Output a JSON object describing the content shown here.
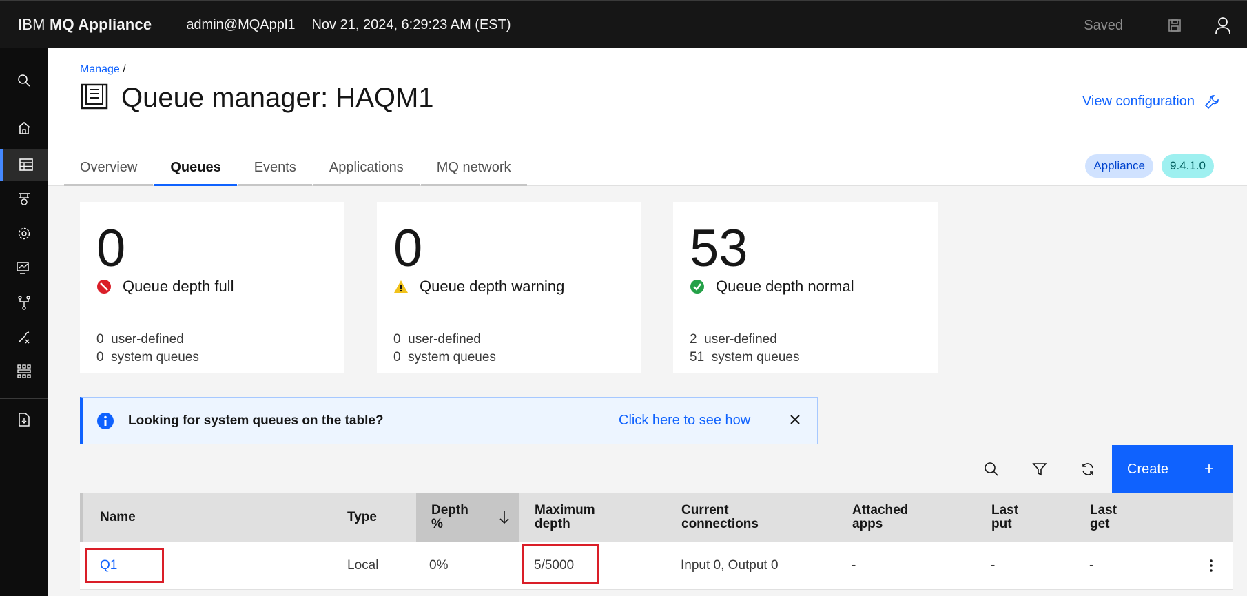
{
  "header": {
    "brand_light": "IBM ",
    "brand_bold": "MQ Appliance",
    "user": "admin@MQAppl1",
    "time": "Nov 21, 2024, 6:29:23 AM (EST)",
    "saved": "Saved"
  },
  "rail": {
    "items": [
      "search",
      "home",
      "manage",
      "events",
      "settings",
      "monitor",
      "network",
      "tools",
      "grid",
      "export"
    ]
  },
  "page": {
    "breadcrumb": "Manage",
    "breadcrumb_sep": " /",
    "title": "Queue manager: HAQM1",
    "view_config": "View configuration",
    "tabs": [
      "Overview",
      "Queues",
      "Events",
      "Applications",
      "MQ network"
    ],
    "active_tab": "Queues",
    "tags": [
      "Appliance",
      "9.4.1.0"
    ]
  },
  "tiles": [
    {
      "count": "0",
      "label": "Queue depth full",
      "user": "0",
      "user_label": "user-defined",
      "system": "0",
      "system_label": "system queues",
      "status": "error"
    },
    {
      "count": "0",
      "label": "Queue depth warning",
      "user": "0",
      "user_label": "user-defined",
      "system": "0",
      "system_label": "system queues",
      "status": "warning"
    },
    {
      "count": "53",
      "label": "Queue depth normal",
      "user": "2",
      "user_label": "user-defined",
      "system": "51",
      "system_label": "system queues",
      "status": "success"
    }
  ],
  "notification": {
    "text": "Looking for system queues on the table?",
    "link": "Click here to see how"
  },
  "toolbar": {
    "create": "Create",
    "plus": "+"
  },
  "table": {
    "headers": {
      "name": "Name",
      "type": "Type",
      "depth_1": "Depth",
      "depth_2": "%",
      "max_1": "Maximum",
      "max_2": "depth",
      "conn_1": "Current",
      "conn_2": "connections",
      "apps_1": "Attached",
      "apps_2": "apps",
      "put_1": "Last",
      "put_2": "put",
      "get_1": "Last",
      "get_2": "get"
    },
    "rows": [
      {
        "name": "Q1",
        "type": "Local",
        "depth": "0%",
        "max_depth": "5/5000",
        "connections": "Input 0, Output 0",
        "apps": "-",
        "last_put": "-",
        "last_get": "-"
      }
    ]
  },
  "colors": {
    "accent": "#0f62fe",
    "error": "#da1e28",
    "warning": "#f1c21b",
    "success": "#24a148",
    "highlight_box": "#da1e28"
  }
}
